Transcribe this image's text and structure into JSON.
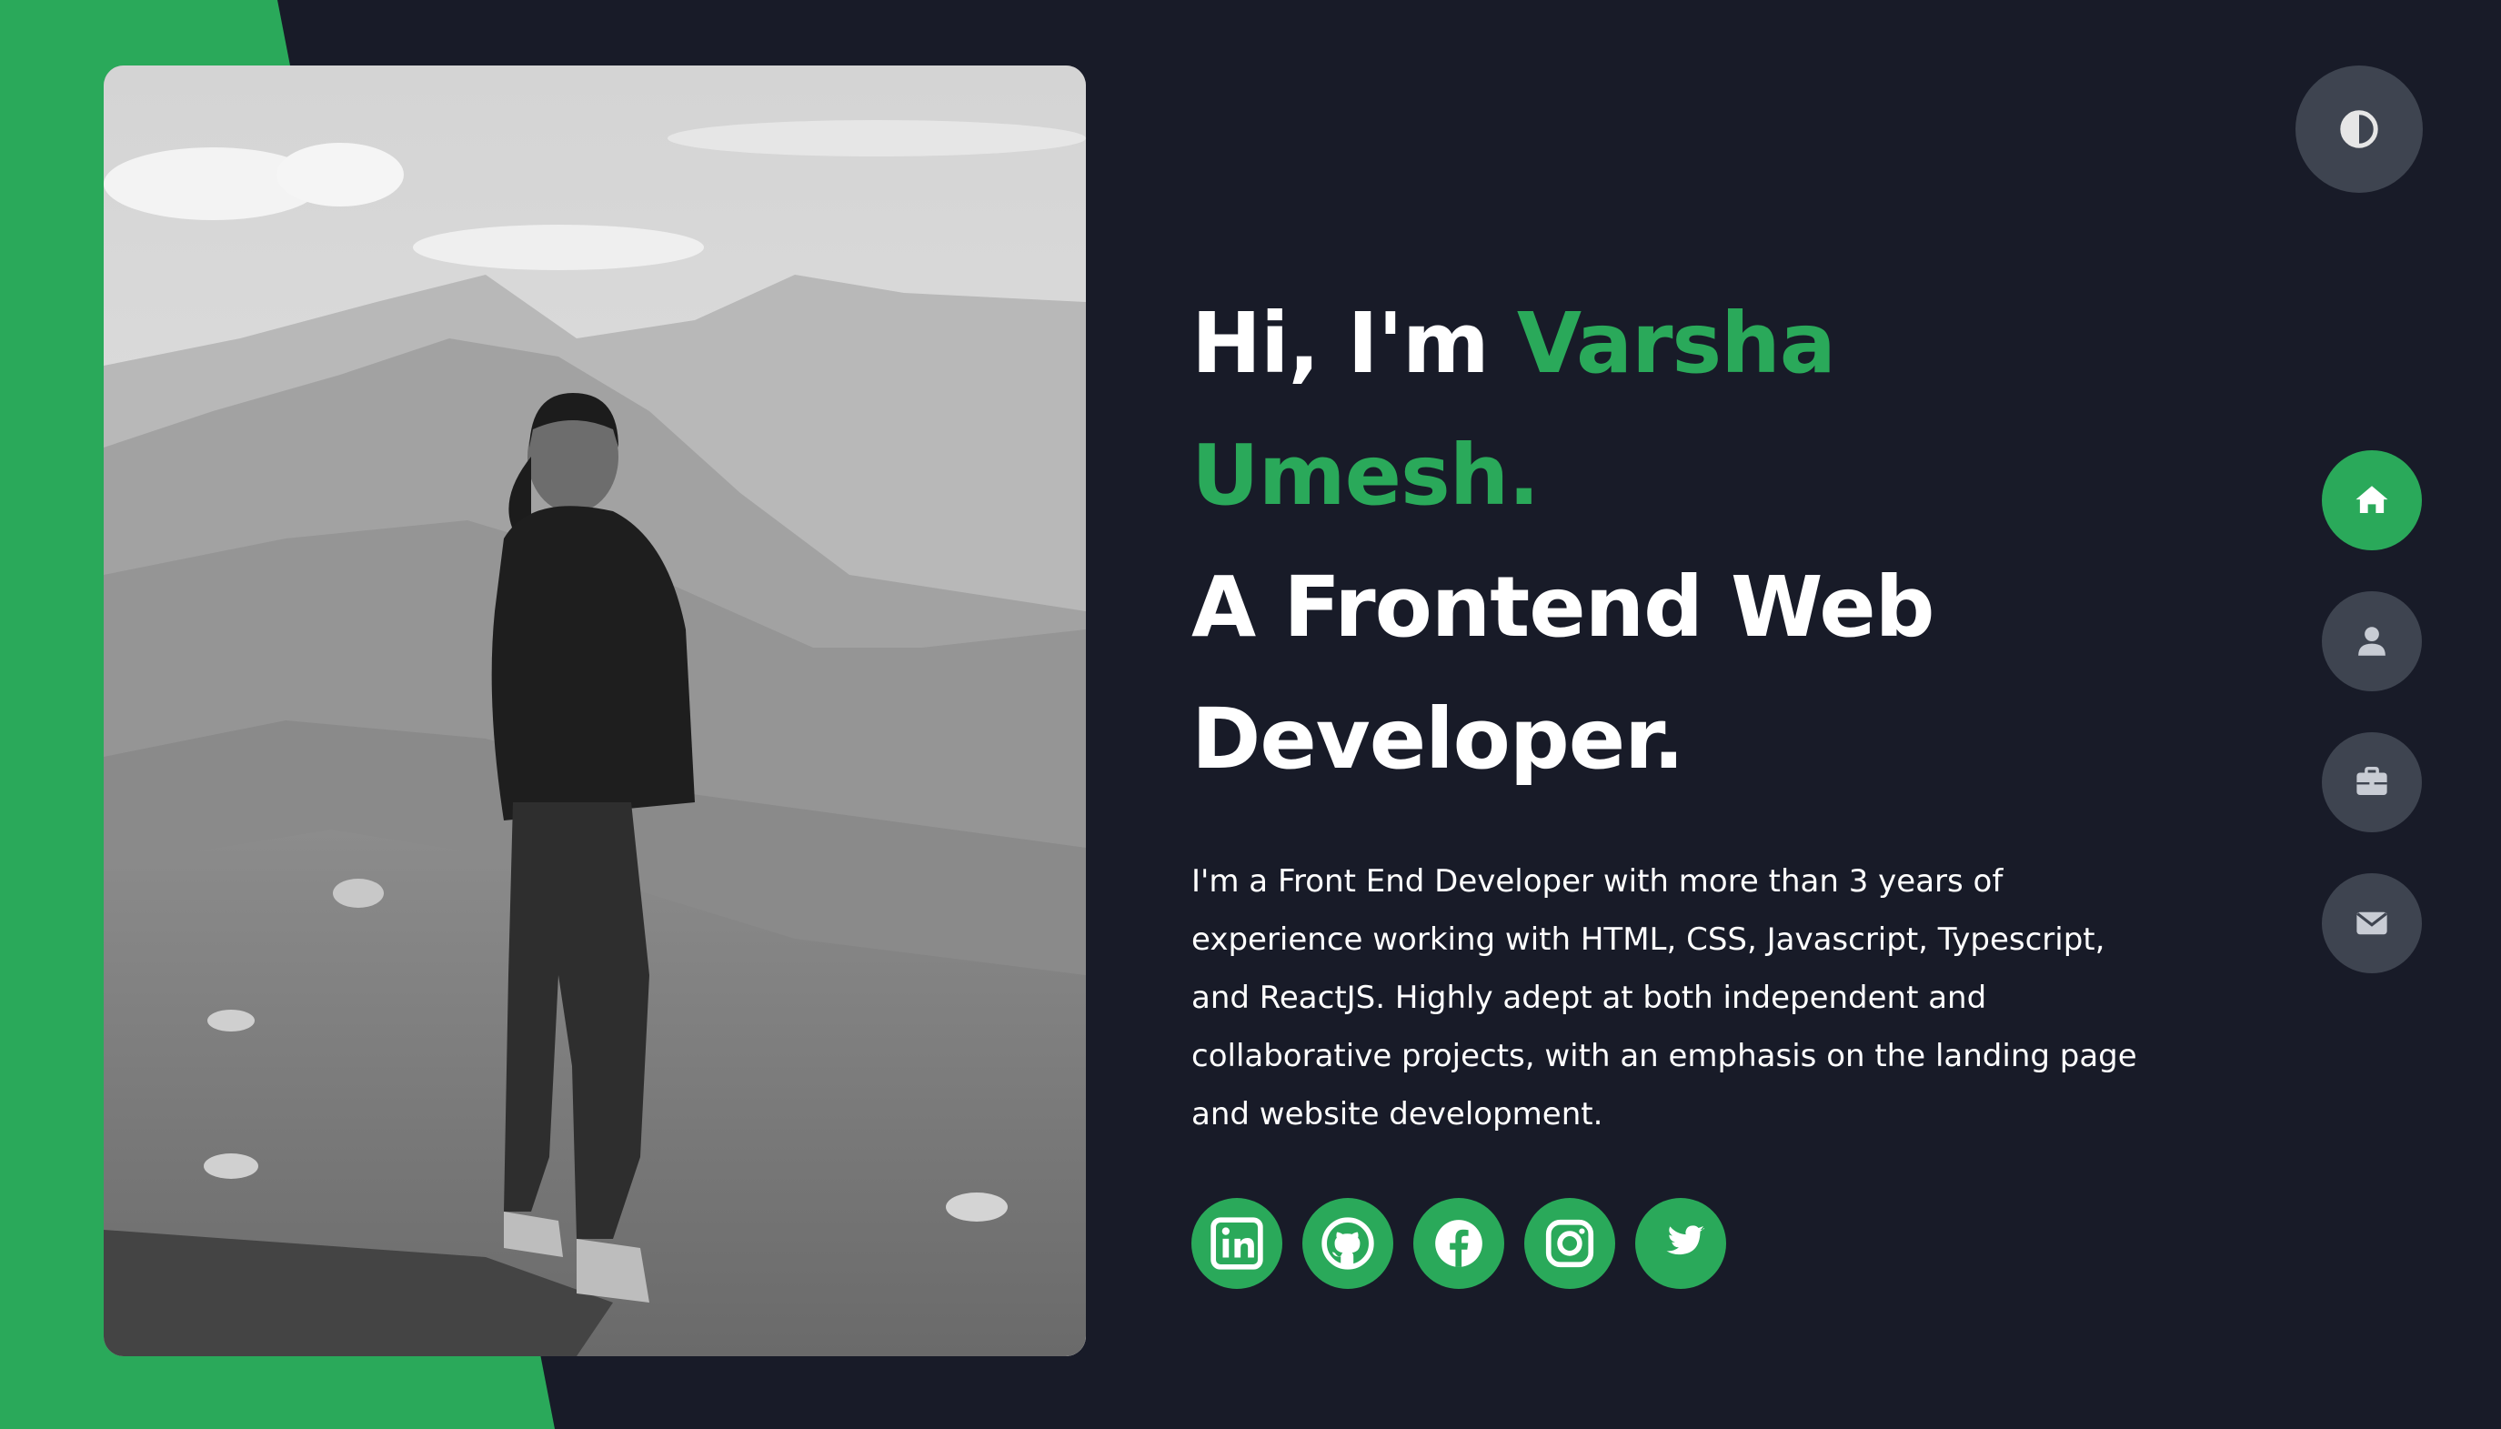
{
  "colors": {
    "background": "#181b28",
    "accent": "#2aa95a",
    "button_gray": "#3e4450",
    "text": "#ffffff"
  },
  "hero": {
    "greeting": "Hi, I'm ",
    "name": "Varsha Umesh.",
    "tagline_line1": "A Frontend Web",
    "tagline_line2": "Developer.",
    "bio": "I'm a Front End Developer with more than 3 years of experience working with HTML, CSS, Javascript, Typescript, and ReactJS. Highly adept at both independent and collaborative projects, with an emphasis on the landing page and website development."
  },
  "socials": [
    {
      "name": "linkedin",
      "icon": "linkedin-icon"
    },
    {
      "name": "github",
      "icon": "github-icon"
    },
    {
      "name": "facebook",
      "icon": "facebook-icon"
    },
    {
      "name": "instagram",
      "icon": "instagram-icon"
    },
    {
      "name": "twitter",
      "icon": "twitter-icon"
    }
  ],
  "theme_toggle": {
    "icon": "contrast-icon"
  },
  "side_nav": [
    {
      "name": "home",
      "icon": "home-icon",
      "active": true
    },
    {
      "name": "about",
      "icon": "user-icon",
      "active": false
    },
    {
      "name": "portfolio",
      "icon": "briefcase-icon",
      "active": false
    },
    {
      "name": "contact",
      "icon": "envelope-icon",
      "active": false
    }
  ],
  "photo": {
    "description_icon": "profile-photo"
  }
}
